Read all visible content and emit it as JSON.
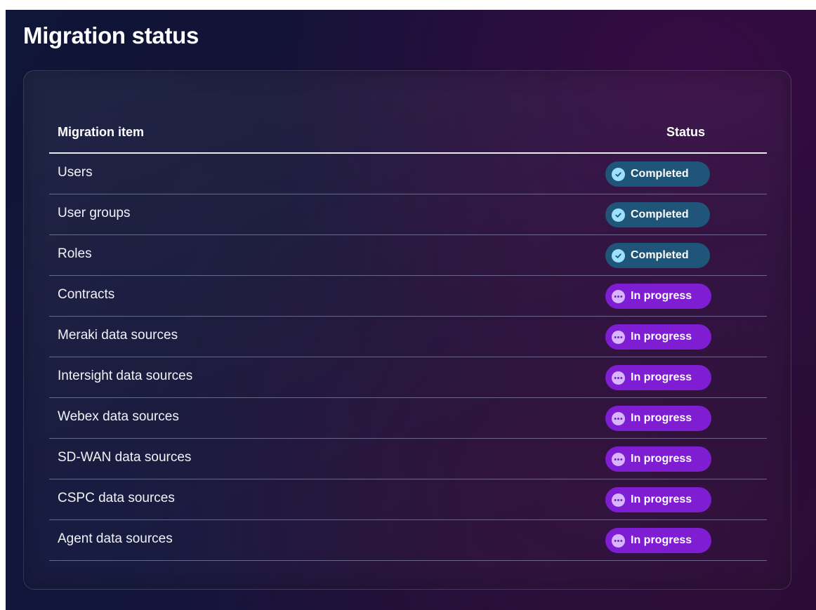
{
  "page": {
    "title": "Migration status"
  },
  "table": {
    "columns": {
      "item": "Migration item",
      "status": "Status"
    },
    "rows": [
      {
        "item": "Users",
        "status": "Completed",
        "state": "completed"
      },
      {
        "item": "User groups",
        "status": "Completed",
        "state": "completed"
      },
      {
        "item": "Roles",
        "status": "Completed",
        "state": "completed"
      },
      {
        "item": "Contracts",
        "status": "In progress",
        "state": "inprogress"
      },
      {
        "item": "Meraki data sources",
        "status": "In progress",
        "state": "inprogress"
      },
      {
        "item": "Intersight data sources",
        "status": "In progress",
        "state": "inprogress"
      },
      {
        "item": "Webex data sources",
        "status": "In progress",
        "state": "inprogress"
      },
      {
        "item": "SD-WAN data sources",
        "status": "In progress",
        "state": "inprogress"
      },
      {
        "item": "CSPC data sources",
        "status": "In progress",
        "state": "inprogress"
      },
      {
        "item": "Agent data sources",
        "status": "In progress",
        "state": "inprogress"
      }
    ]
  },
  "icons": {
    "completed": "check-circle-icon",
    "inprogress": "ellipsis-circle-icon"
  },
  "colors": {
    "completed_badge": "#1f5578",
    "completed_icon": "#9ee1ff",
    "inprogress_badge": "#7f1dd3",
    "inprogress_icon": "#d8b6ff"
  }
}
